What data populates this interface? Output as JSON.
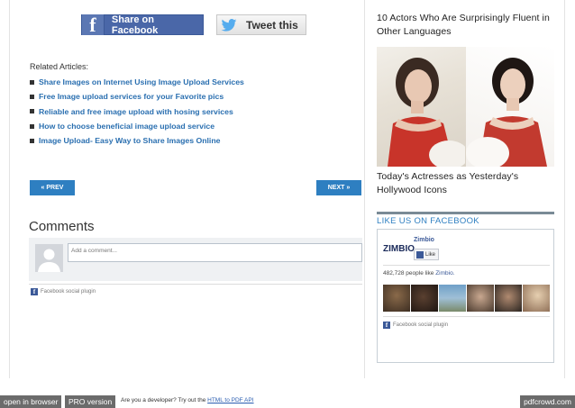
{
  "share": {
    "facebook_label": "Share on Facebook",
    "twitter_label": "Tweet this"
  },
  "related": {
    "label": "Related Articles:",
    "items": [
      "Share Images on Internet Using Image Upload Services",
      "Free Image upload services for your Favorite pics",
      "Reliable and free image upload with hosing services",
      "How to choose beneficial image upload service",
      "Image Upload- Easy Way to Share Images Online"
    ]
  },
  "nav": {
    "prev": "« PREV",
    "next": "NEXT »"
  },
  "comments": {
    "title": "Comments",
    "placeholder": "Add a comment...",
    "plugin_label": "Facebook social plugin"
  },
  "sidebar": {
    "card1_title": "10 Actors Who Are Surprisingly Fluent in Other Languages",
    "card2_title": "Today's Actresses as Yesterday's Hollywood Icons",
    "like_title": "LIKE US ON FACEBOOK",
    "page_name": "Zimbio",
    "logo_text": "ZIMBIO",
    "like_button": "Like",
    "like_count_prefix": "482,728 people like",
    "like_count_link": "Zimbio.",
    "plugin_label": "Facebook social plugin"
  },
  "footer": {
    "open_label": "open in browser",
    "pro_label": "PRO version",
    "dev_text": "Are you a developer? Try out the",
    "dev_link": "HTML to PDF API",
    "brand": "pdfcrowd.com"
  },
  "colors": {
    "facebook": "#3b5998",
    "link_blue": "#2a6fb0",
    "nav_button": "#2e7fc1",
    "like_header_bar": "#7a8b96"
  }
}
